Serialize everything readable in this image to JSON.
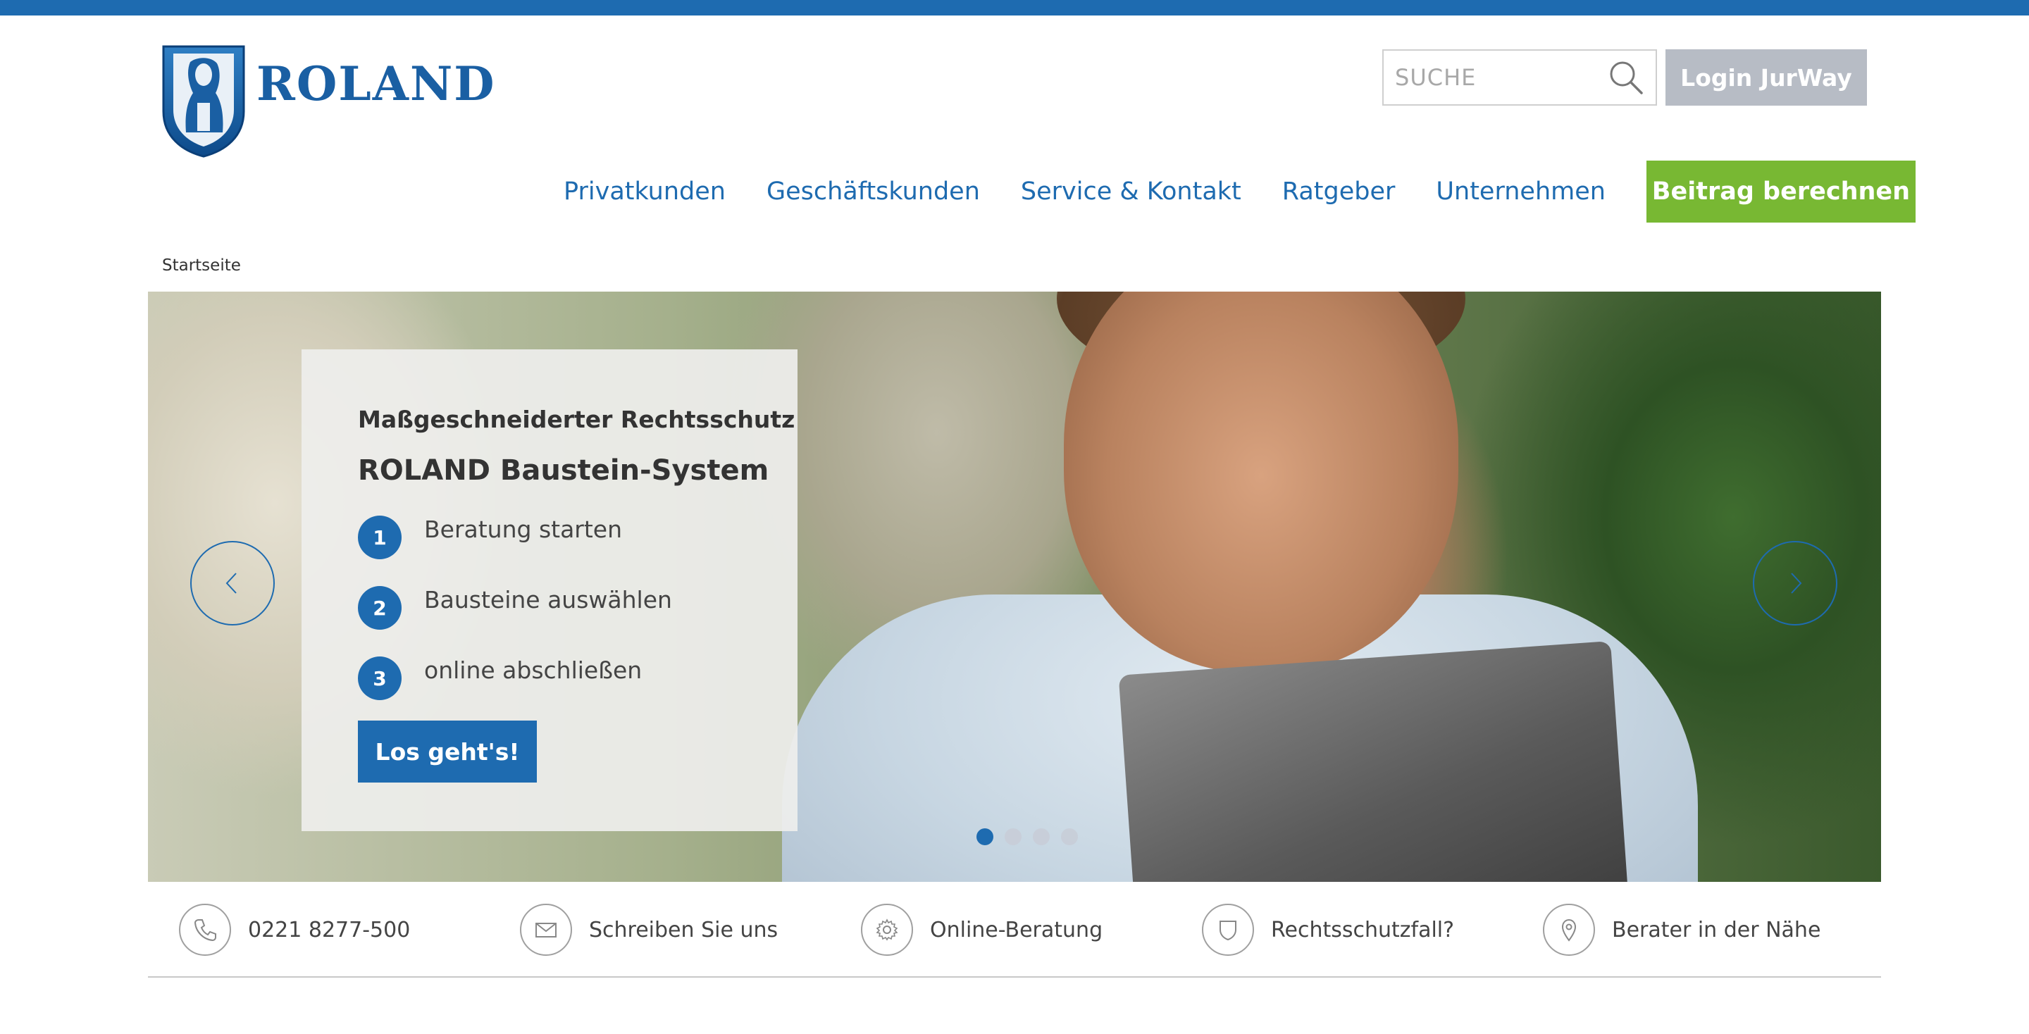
{
  "brand": {
    "name": "ROLAND",
    "primary_color": "#1e6bb0",
    "cta_color": "#78b833"
  },
  "header": {
    "search_placeholder": "SUCHE",
    "login_label": "Login JurWay"
  },
  "nav": {
    "items": [
      {
        "label": "Privatkunden"
      },
      {
        "label": "Geschäftskunden"
      },
      {
        "label": "Service & Kontakt"
      },
      {
        "label": "Ratgeber"
      },
      {
        "label": "Unternehmen"
      }
    ],
    "cta_label": "Beitrag berechnen"
  },
  "breadcrumb": {
    "current": "Startseite"
  },
  "hero": {
    "subtitle": "Maßgeschneiderter Rechtsschutz",
    "title": "ROLAND Baustein-System",
    "steps": [
      {
        "number": "1",
        "label": "Beratung starten"
      },
      {
        "number": "2",
        "label": "Bausteine auswählen"
      },
      {
        "number": "3",
        "label": "online abschließen"
      }
    ],
    "button_label": "Los geht's!",
    "slide_count": 4,
    "active_slide": 1
  },
  "contact_bar": {
    "items": [
      {
        "icon": "phone-icon",
        "label": "0221 8277-500"
      },
      {
        "icon": "mail-icon",
        "label": "Schreiben Sie uns"
      },
      {
        "icon": "gear-icon",
        "label": "Online-Beratung"
      },
      {
        "icon": "shield-icon",
        "label": "Rechtsschutzfall?"
      },
      {
        "icon": "location-pin-icon",
        "label": "Berater in der Nähe"
      }
    ]
  }
}
